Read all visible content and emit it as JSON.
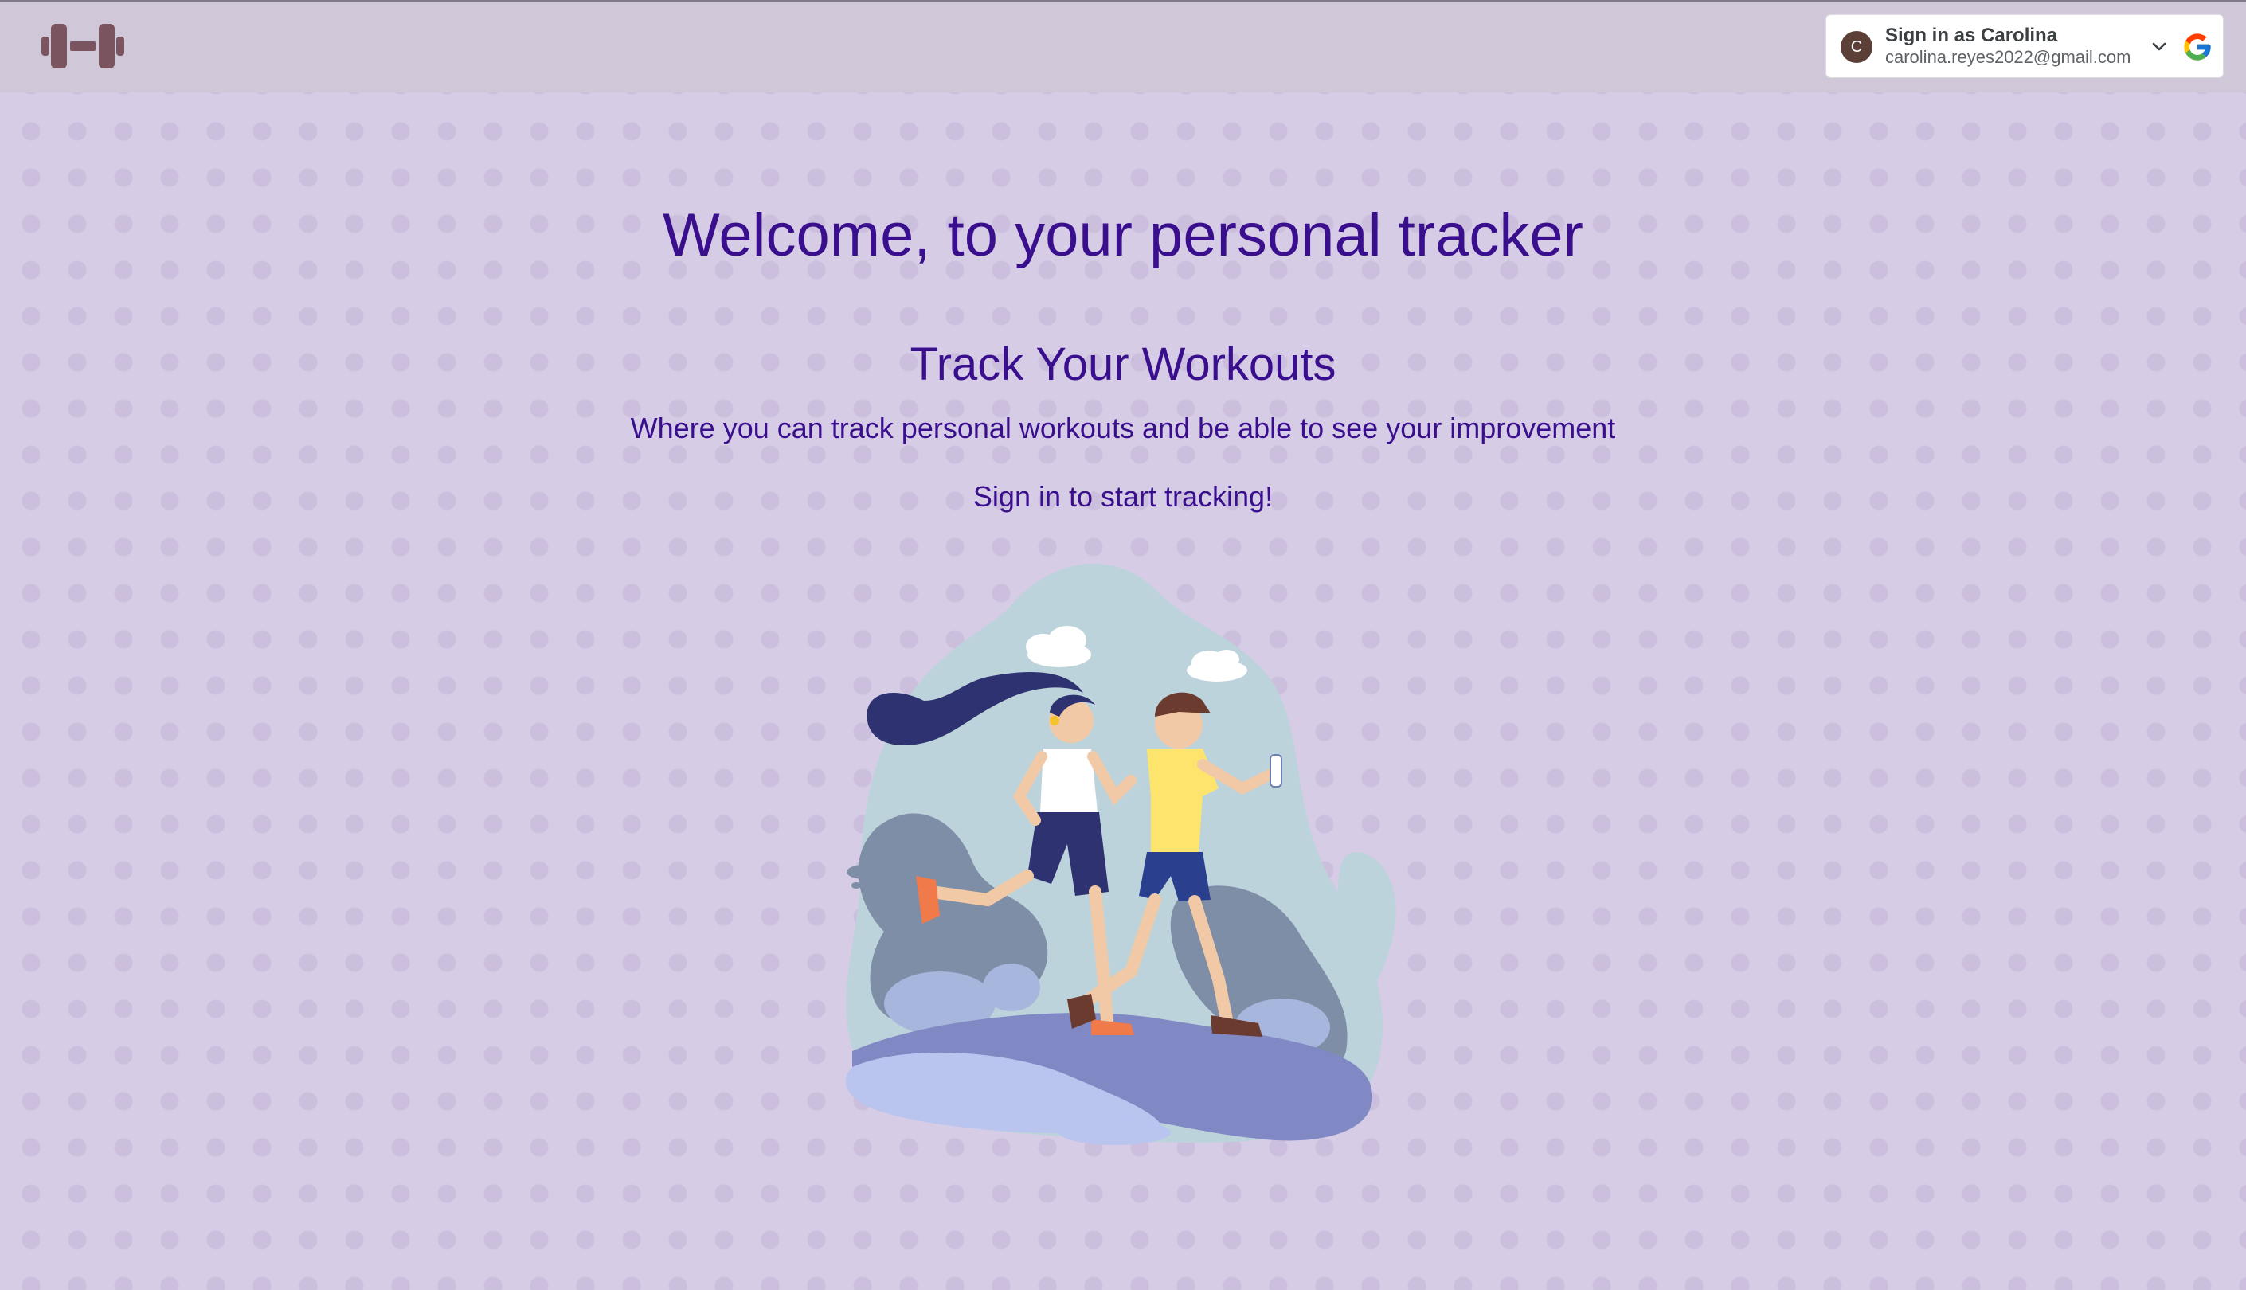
{
  "header": {
    "logo": "dumbbell-icon",
    "google_signin": {
      "avatar_initial": "C",
      "title": "Sign in as Carolina",
      "email": "carolina.reyes2022@gmail.com",
      "chevron": "chevron-down-icon",
      "brand_icon": "google-g-icon"
    }
  },
  "main": {
    "welcome": "Welcome, to your personal tracker",
    "subtitle": "Track Your Workouts",
    "description": "Where you can track personal workouts and be able to see your improvement",
    "cta": "Sign in to start tracking!",
    "illustration": "two-runners-illustration"
  },
  "colors": {
    "background": "#d6cce6",
    "topbar": "#d0c8d8",
    "heading_text": "#3a0f8e",
    "logo": "#7a5560"
  }
}
